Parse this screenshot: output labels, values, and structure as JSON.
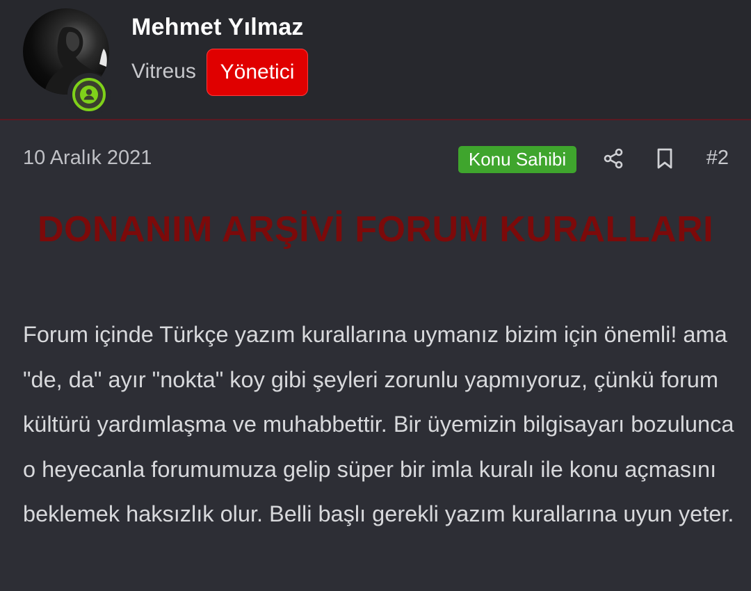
{
  "author": {
    "name": "Mehmet Yılmaz",
    "title": "Vitreus",
    "role_badge": "Yönetici",
    "status_icon": "user-online-icon",
    "role_color": "#e00000",
    "status_color": "#7fd11a"
  },
  "post": {
    "date": "10 Aralık 2021",
    "owner_badge": "Konu Sahibi",
    "owner_badge_color": "#3fa52d",
    "number": "#2",
    "actions": [
      {
        "icon": "share-icon"
      },
      {
        "icon": "bookmark-icon"
      }
    ],
    "heading": "DONANIM ARŞİVİ FORUM KURALLARI",
    "heading_color": "#7c0a0a",
    "body": "Forum içinde Türkçe yazım kurallarına uymanız bizim için önemli! ama \"de, da\" ayır \"nokta\" koy gibi şeyleri zorunlu yapmıyoruz, çünkü forum kültürü yardımlaşma ve muhabbettir. Bir üyemizin bilgisayarı bozulunca o heyecanla forumumuza gelip süper bir imla kuralı ile konu açmasını beklemek haksızlık olur. Belli başlı gerekli yazım kurallarına uyun yeter."
  }
}
